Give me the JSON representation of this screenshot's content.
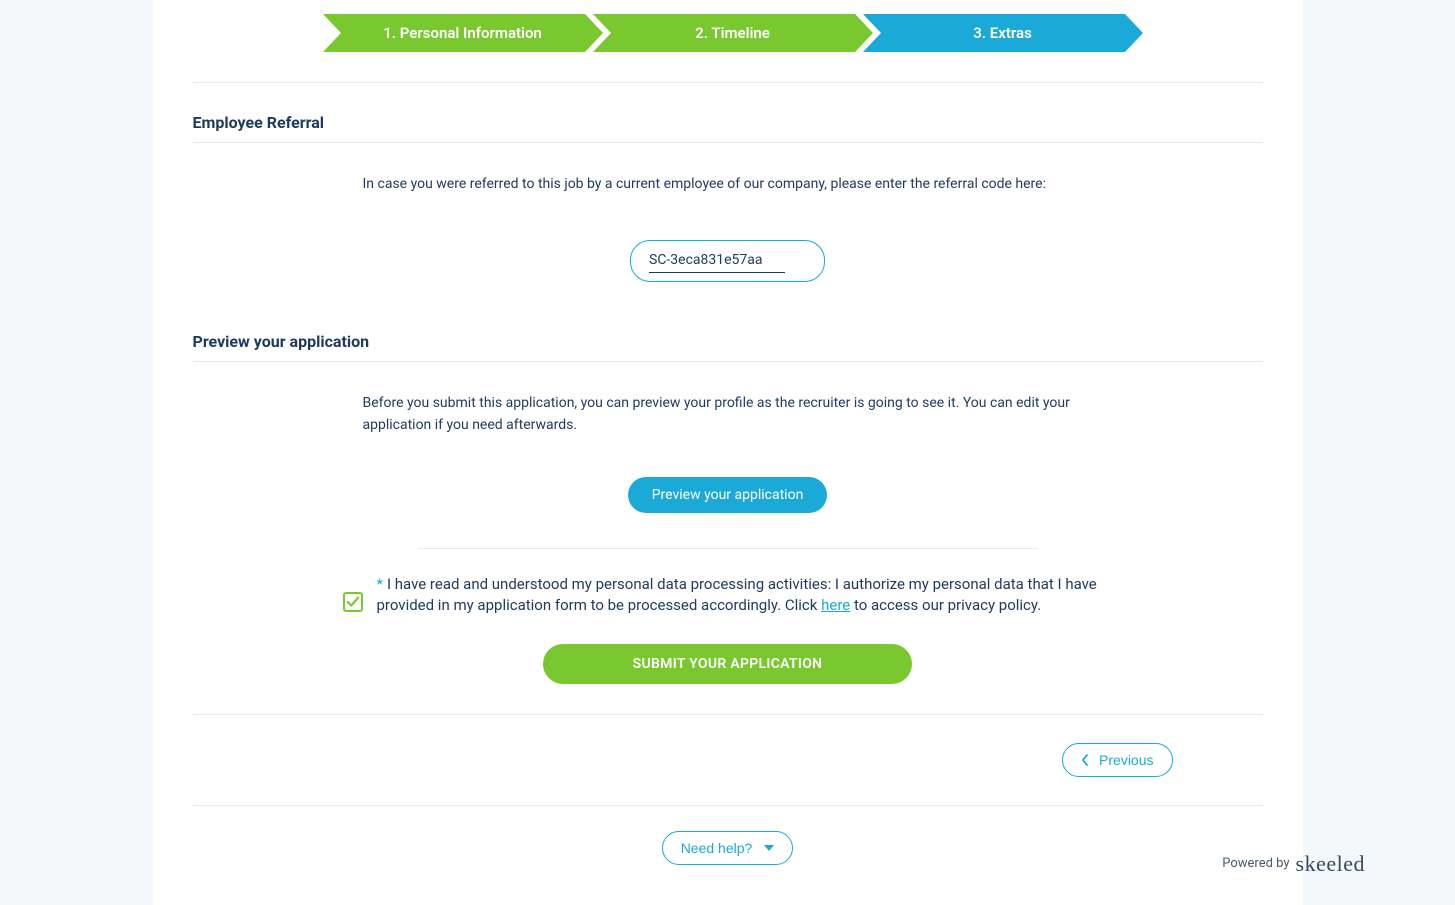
{
  "stepper": {
    "step1": "1. Personal Information",
    "step2": "2. Timeline",
    "step3": "3. Extras"
  },
  "referral": {
    "title": "Employee Referral",
    "intro": "In case you were referred to this job by a current employee of our company, please enter the referral code here:",
    "value": "SC-3eca831e57aa"
  },
  "preview": {
    "title": "Preview your application",
    "intro": "Before you submit this application, you can preview your profile as the recruiter is going to see it. You can edit your application if you need afterwards.",
    "button": "Preview your application"
  },
  "consent": {
    "prefix": "I have read and understood my personal data processing activities: I authorize my personal data that I have provided in my application form to be processed accordingly. Click ",
    "link": "here",
    "suffix": " to access our privacy policy.",
    "checked": true
  },
  "submit": {
    "label": "SUBMIT YOUR APPLICATION"
  },
  "nav": {
    "previous": "Previous"
  },
  "help": {
    "label": "Need help?"
  },
  "footer": {
    "powered": "Powered by",
    "brand": "skeeled"
  }
}
